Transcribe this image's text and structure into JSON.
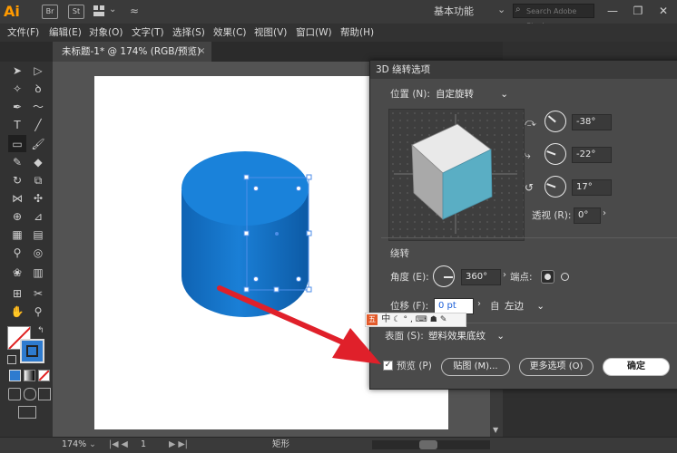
{
  "app": {
    "logo": "Ai",
    "bridge_label": "Br",
    "stock_label": "St",
    "workspace": "基本功能",
    "search_placeholder": "Search Adobe Stock"
  },
  "window_controls": {
    "minimize": "—",
    "restore": "❐",
    "close": "✕"
  },
  "menu": [
    "文件(F)",
    "编辑(E)",
    "对象(O)",
    "文字(T)",
    "选择(S)",
    "效果(C)",
    "视图(V)",
    "窗口(W)",
    "帮助(H)"
  ],
  "document_tab": {
    "title": "未标题-1* @ 174% (RGB/预览)",
    "close": "×"
  },
  "statusbar": {
    "zoom": "174%",
    "artboard": "1",
    "tool": "矩形"
  },
  "dialog": {
    "title": "3D 绕转选项",
    "position_label": "位置 (N):",
    "position_value": "自定旋转",
    "rot_x": "-38°",
    "rot_y": "-22°",
    "rot_z": "17°",
    "perspective_label": "透视 (R):",
    "perspective_value": "0°",
    "revolve_section": "绕转",
    "angle_label": "角度 (E):",
    "angle_value": "360°",
    "cap_label": "端点:",
    "offset_label": "位移 (F):",
    "offset_value": "0 pt",
    "from_label": "自",
    "from_value": "左边",
    "surface_label": "表面 (S):",
    "surface_value": "塑料效果底纹",
    "preview_label": "预览 (P)",
    "map_button": "贴图 (M)...",
    "more_button": "更多选项 (O)",
    "ok_button": "确定"
  },
  "ime": {
    "label": "中"
  },
  "colors": {
    "cylinder": "#1a7fd6",
    "cube_side": "#5aaec4",
    "arrow": "#e0202a",
    "dialog_bg": "#4a4a4a"
  }
}
